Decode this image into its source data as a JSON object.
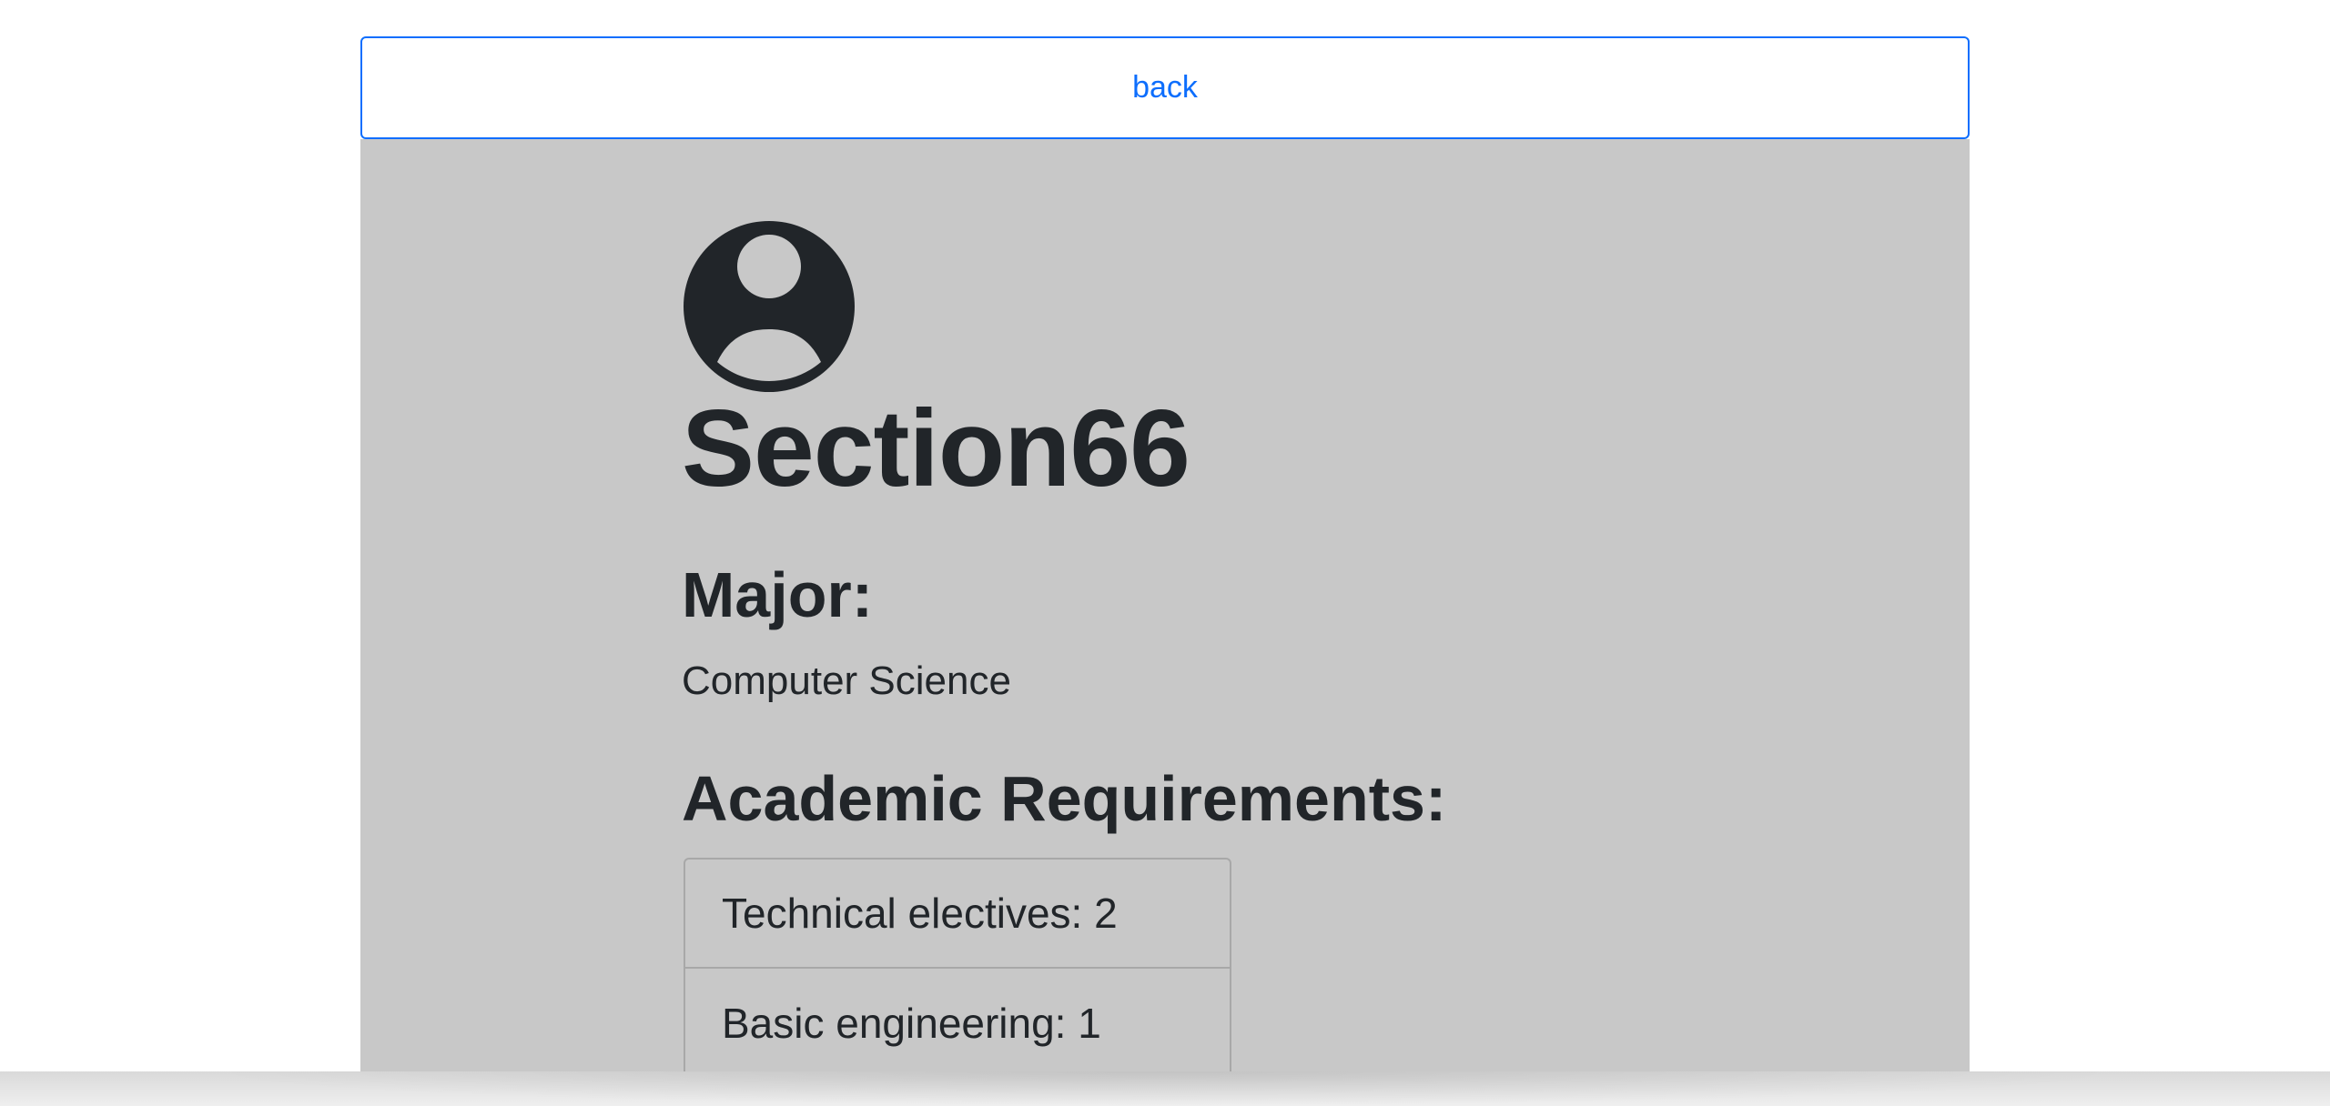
{
  "header": {
    "back_label": "back"
  },
  "profile": {
    "avatar_icon": "person-circle-icon",
    "username": "Section66",
    "major_heading": "Major:",
    "major_value": "Computer Science",
    "requirements_heading": "Academic Requirements:",
    "requirements": [
      {
        "label": "Technical electives: 2"
      },
      {
        "label": "Basic engineering: 1"
      }
    ]
  },
  "colors": {
    "accent": "#0d6efd",
    "panel_background": "#c8c8c8",
    "text": "#212529"
  }
}
